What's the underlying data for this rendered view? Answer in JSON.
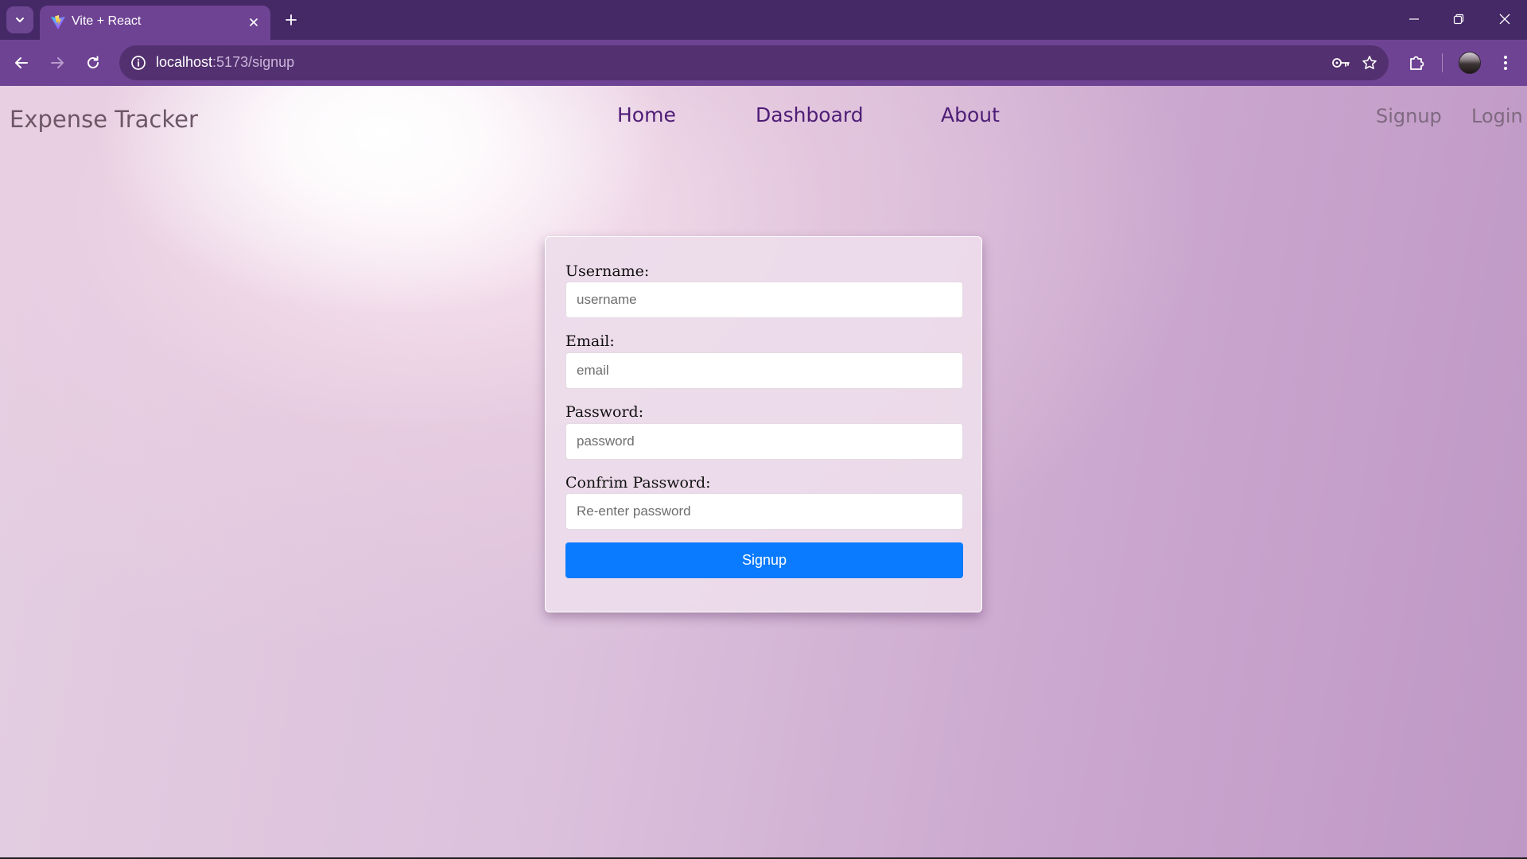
{
  "browser": {
    "tab_title": "Vite + React",
    "url_host": "localhost",
    "url_path": ":5173/signup"
  },
  "header": {
    "brand": "Expense Tracker",
    "nav": [
      "Home",
      "Dashboard",
      "About"
    ],
    "auth": [
      "Signup",
      "Login"
    ]
  },
  "form": {
    "fields": [
      {
        "label": "Username:",
        "placeholder": "username",
        "value": ""
      },
      {
        "label": "Email:",
        "placeholder": "email",
        "value": ""
      },
      {
        "label": "Password:",
        "placeholder": "password",
        "value": ""
      },
      {
        "label": "Confrim Password:",
        "placeholder": "Re-enter password",
        "value": ""
      }
    ],
    "submit_label": "Signup"
  },
  "colors": {
    "browser_frame": "#452866",
    "toolbar": "#6f4393",
    "nav_link": "#4d1d76",
    "primary_button": "#0a7bff"
  },
  "icons": {
    "tab_search": "chevron-down-icon",
    "favicon": "vite-logo-icon",
    "tab_close": "close-icon",
    "new_tab": "plus-icon",
    "back": "back-arrow-icon",
    "forward": "forward-arrow-icon",
    "reload": "reload-icon",
    "site_info": "info-icon",
    "password_manager": "key-icon",
    "bookmark": "star-icon",
    "extensions": "puzzle-icon",
    "profile": "avatar",
    "menu": "kebab-menu-icon"
  }
}
